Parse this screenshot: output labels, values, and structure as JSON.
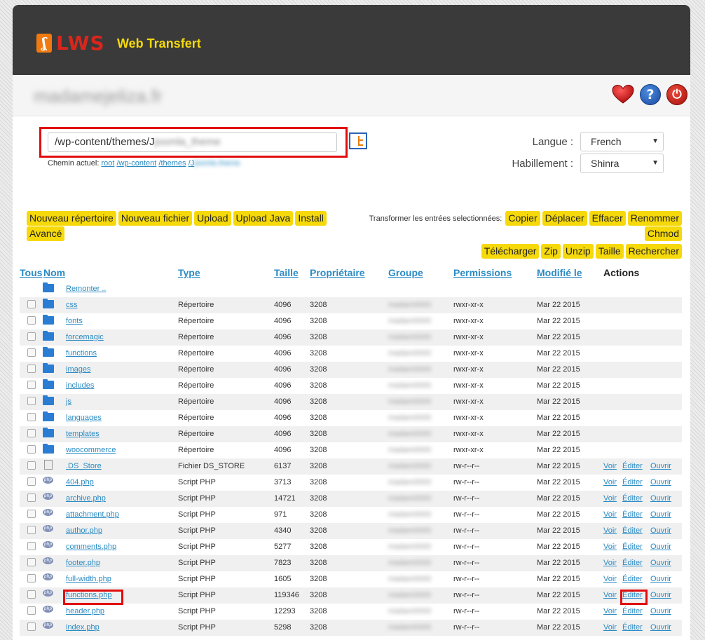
{
  "header": {
    "logo_text": "LWS",
    "app_title": "Web Transfert",
    "domain": "madamejeliza.fr"
  },
  "path": {
    "value": "/wp-content/themes/J",
    "value_obscured": "joomla_theme",
    "crumb_label": "Chemin actuel:",
    "crumbs": [
      "root",
      "/wp-content",
      "/themes",
      "/J"
    ],
    "crumb_obscured": "jsomla theme"
  },
  "settings": {
    "language_label": "Langue :",
    "language_value": "French",
    "skin_label": "Habillement :",
    "skin_value": "Shinra"
  },
  "toolbar": {
    "new_dir": "Nouveau répertoire",
    "new_file": "Nouveau fichier",
    "upload": "Upload",
    "upload_java": "Upload Java",
    "install": "Install",
    "advanced": "Avancé",
    "transform_label": "Transformer les entrées selectionnées:",
    "copy": "Copier",
    "move": "Déplacer",
    "delete": "Effacer",
    "rename": "Renommer",
    "chmod": "Chmod",
    "download": "Télécharger",
    "zip": "Zip",
    "unzip": "Unzip",
    "size": "Taille",
    "search": "Rechercher"
  },
  "table": {
    "headers": {
      "all": "Tous",
      "name": "Nom",
      "type": "Type",
      "size": "Taille",
      "owner": "Propriétaire",
      "group": "Groupe",
      "permissions": "Permissions",
      "modified": "Modifié le",
      "actions": "Actions"
    },
    "up_label": "Remonter ..",
    "group_obscured": "madam0000",
    "action_labels": {
      "view": "Voir",
      "edit": "Éditer",
      "open": "Ouvrir"
    },
    "rows": [
      {
        "name": "css",
        "type": "Répertoire",
        "size": "4096",
        "owner": "3208",
        "perm": "rwxr-xr-x",
        "date": "Mar 22 2015"
      },
      {
        "name": "fonts",
        "type": "Répertoire",
        "size": "4096",
        "owner": "3208",
        "perm": "rwxr-xr-x",
        "date": "Mar 22 2015"
      },
      {
        "name": "forcemagic",
        "type": "Répertoire",
        "size": "4096",
        "owner": "3208",
        "perm": "rwxr-xr-x",
        "date": "Mar 22 2015"
      },
      {
        "name": "functions",
        "type": "Répertoire",
        "size": "4096",
        "owner": "3208",
        "perm": "rwxr-xr-x",
        "date": "Mar 22 2015"
      },
      {
        "name": "images",
        "type": "Répertoire",
        "size": "4096",
        "owner": "3208",
        "perm": "rwxr-xr-x",
        "date": "Mar 22 2015"
      },
      {
        "name": "includes",
        "type": "Répertoire",
        "size": "4096",
        "owner": "3208",
        "perm": "rwxr-xr-x",
        "date": "Mar 22 2015"
      },
      {
        "name": "js",
        "type": "Répertoire",
        "size": "4096",
        "owner": "3208",
        "perm": "rwxr-xr-x",
        "date": "Mar 22 2015"
      },
      {
        "name": "languages",
        "type": "Répertoire",
        "size": "4096",
        "owner": "3208",
        "perm": "rwxr-xr-x",
        "date": "Mar 22 2015"
      },
      {
        "name": "templates",
        "type": "Répertoire",
        "size": "4096",
        "owner": "3208",
        "perm": "rwxr-xr-x",
        "date": "Mar 22 2015"
      },
      {
        "name": "woocommerce",
        "type": "Répertoire",
        "size": "4096",
        "owner": "3208",
        "perm": "rwxr-xr-x",
        "date": "Mar 22 2015"
      },
      {
        "name": ".DS_Store",
        "type": "Fichier DS_STORE",
        "size": "6137",
        "owner": "3208",
        "perm": "rw-r--r--",
        "date": "Mar 22 2015"
      },
      {
        "name": "404.php",
        "type": "Script PHP",
        "size": "3713",
        "owner": "3208",
        "perm": "rw-r--r--",
        "date": "Mar 22 2015"
      },
      {
        "name": "archive.php",
        "type": "Script PHP",
        "size": "14721",
        "owner": "3208",
        "perm": "rw-r--r--",
        "date": "Mar 22 2015"
      },
      {
        "name": "attachment.php",
        "type": "Script PHP",
        "size": "971",
        "owner": "3208",
        "perm": "rw-r--r--",
        "date": "Mar 22 2015"
      },
      {
        "name": "author.php",
        "type": "Script PHP",
        "size": "4340",
        "owner": "3208",
        "perm": "rw-r--r--",
        "date": "Mar 22 2015"
      },
      {
        "name": "comments.php",
        "type": "Script PHP",
        "size": "5277",
        "owner": "3208",
        "perm": "rw-r--r--",
        "date": "Mar 22 2015"
      },
      {
        "name": "footer.php",
        "type": "Script PHP",
        "size": "7823",
        "owner": "3208",
        "perm": "rw-r--r--",
        "date": "Mar 22 2015"
      },
      {
        "name": "full-width.php",
        "type": "Script PHP",
        "size": "1605",
        "owner": "3208",
        "perm": "rw-r--r--",
        "date": "Mar 22 2015"
      },
      {
        "name": "functions.php",
        "type": "Script PHP",
        "size": "119346",
        "owner": "3208",
        "perm": "rw-r--r--",
        "date": "Mar 22 2015"
      },
      {
        "name": "header.php",
        "type": "Script PHP",
        "size": "12293",
        "owner": "3208",
        "perm": "rw-r--r--",
        "date": "Mar 22 2015"
      },
      {
        "name": "index.php",
        "type": "Script PHP",
        "size": "5298",
        "owner": "3208",
        "perm": "rw-r--r--",
        "date": "Mar 22 2015"
      }
    ]
  }
}
